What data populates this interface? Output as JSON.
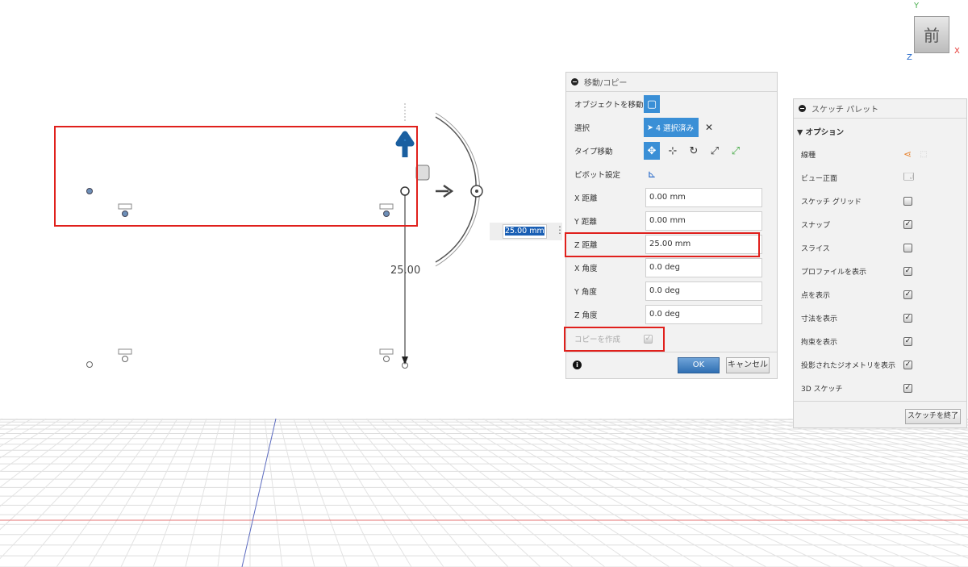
{
  "viewcube": {
    "face": "前",
    "axis_y": "Y",
    "axis_x": "X",
    "axis_z": "Z"
  },
  "canvas": {
    "dimension_label": "25.00",
    "floating_input": "25.00 mm"
  },
  "move_dialog": {
    "title": "移動/コピー",
    "rows": {
      "object": "オブジェクトを移動",
      "select": "選択",
      "select_button": "4 選択済み",
      "clear": "✕",
      "type": "タイプ移動",
      "pivot": "ピボット設定",
      "x_dist": "X 距離",
      "x_dist_val": "0.00 mm",
      "y_dist": "Y 距離",
      "y_dist_val": "0.00 mm",
      "z_dist": "Z 距離",
      "z_dist_val": "25.00 mm",
      "x_ang": "X 角度",
      "x_ang_val": "0.0 deg",
      "y_ang": "Y 角度",
      "y_ang_val": "0.0 deg",
      "z_ang": "Z 角度",
      "z_ang_val": "0.0 deg",
      "copy": "コピーを作成",
      "copy_check": "✓"
    },
    "ok": "OK",
    "cancel": "キャンセル",
    "info": "i"
  },
  "sketch_palette": {
    "title": "スケッチ パレット",
    "section": "▼ オプション",
    "items": [
      {
        "label": "線種"
      },
      {
        "label": "ビュー正面"
      },
      {
        "label": "スケッチ グリッド",
        "checked": ""
      },
      {
        "label": "スナップ",
        "checked": "✓"
      },
      {
        "label": "スライス",
        "checked": ""
      },
      {
        "label": "プロファイルを表示",
        "checked": "✓"
      },
      {
        "label": "点を表示",
        "checked": "✓"
      },
      {
        "label": "寸法を表示",
        "checked": "✓"
      },
      {
        "label": "拘束を表示",
        "checked": "✓"
      },
      {
        "label": "投影されたジオメトリを表示",
        "checked": "✓"
      },
      {
        "label": "3D スケッチ",
        "checked": "✓"
      }
    ],
    "finish": "スケッチを終了"
  }
}
